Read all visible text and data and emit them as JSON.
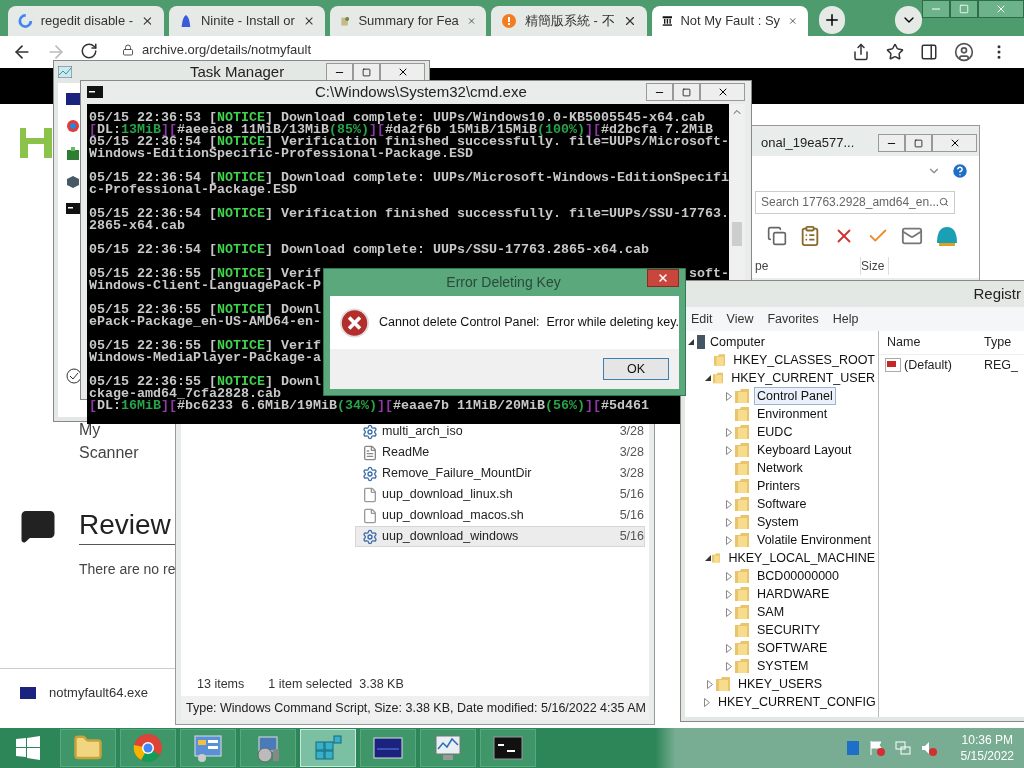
{
  "browser": {
    "tabs": [
      {
        "title": "regedit disable -",
        "kind": "google",
        "selected": false
      },
      {
        "title": "Ninite - Install or",
        "kind": "ninite",
        "selected": false
      },
      {
        "title": "Summary for Fea",
        "kind": "summary",
        "selected": false
      },
      {
        "title": "精簡版系統 - 不",
        "kind": "orange",
        "selected": false
      },
      {
        "title": "Not My Fault : Sy",
        "kind": "archive",
        "selected": true
      }
    ],
    "url": "archive.org/details/notmyfault",
    "page": {
      "side_lines": [
        "My",
        "Scanner"
      ],
      "section_title": "Review",
      "section_text": "There are no re",
      "download": "notmyfault64.exe"
    }
  },
  "explorer_top": {
    "title": "onal_19ea577...",
    "search_placeholder": "Search 17763.2928_amd64_en...",
    "columns": [
      "pe",
      "Size"
    ]
  },
  "explorer_files": {
    "files": [
      {
        "name": "multi_arch_iso",
        "date": "3/28",
        "kind": "script",
        "selected": false
      },
      {
        "name": "ReadMe",
        "date": "3/28",
        "kind": "text",
        "selected": false
      },
      {
        "name": "Remove_Failure_MountDir",
        "date": "3/28",
        "kind": "script",
        "selected": false
      },
      {
        "name": "uup_download_linux.sh",
        "date": "5/16",
        "kind": "blank",
        "selected": false
      },
      {
        "name": "uup_download_macos.sh",
        "date": "5/16",
        "kind": "blank",
        "selected": false
      },
      {
        "name": "uup_download_windows",
        "date": "5/16",
        "kind": "script",
        "selected": true
      }
    ],
    "item_count": "13 items",
    "selection": "1 item selected  3.38 KB",
    "details": "Type: Windows Command Script, Size: 3.38 KB, Date modified: 5/16/2022 4:35 AM"
  },
  "task_manager": {
    "title": "Task Manager"
  },
  "console": {
    "title": "C:\\Windows\\System32\\cmd.exe",
    "entries": [
      {
        "lines": [
          {
            "segments": [
              {
                "text": "05/15 22:36:53 [",
                "kind": "text"
              },
              {
                "text": "NOTICE",
                "kind": "notice"
              },
              {
                "text": "] Download complete: UUPs/Windows10.0-KB5005545-x64.cab",
                "kind": "text"
              }
            ]
          },
          {
            "segments": [
              {
                "text": "[",
                "kind": "bracket"
              },
              {
                "text": "DL:",
                "kind": "text"
              },
              {
                "text": "13MiB",
                "kind": "value"
              },
              {
                "text": "][",
                "kind": "bracket"
              },
              {
                "text": "#aeeac8 11MiB/13MiB",
                "kind": "text"
              },
              {
                "text": "(85%)",
                "kind": "value"
              },
              {
                "text": "][",
                "kind": "bracket"
              },
              {
                "text": "#da2f6b 15MiB/15MiB",
                "kind": "text"
              },
              {
                "text": "(100%)",
                "kind": "value"
              },
              {
                "text": "][",
                "kind": "bracket"
              },
              {
                "text": "#d2bcfa 7.2MiB",
                "kind": "text"
              }
            ]
          },
          {
            "segments": [
              {
                "text": "05/15 22:36:54 [",
                "kind": "text"
              },
              {
                "text": "NOTICE",
                "kind": "notice"
              },
              {
                "text": "] Verification finished successfully. file=UUPs/Microsoft-",
                "kind": "text"
              }
            ]
          },
          {
            "segments": [
              {
                "text": "Windows-EditionSpecific-Professional-Package.ESD",
                "kind": "text"
              }
            ]
          }
        ]
      },
      {
        "lines": [
          {
            "segments": [
              {
                "text": "05/15 22:36:54 [",
                "kind": "text"
              },
              {
                "text": "NOTICE",
                "kind": "notice"
              },
              {
                "text": "] Download complete: UUPs/Microsoft-Windows-EditionSpecifi",
                "kind": "text"
              }
            ]
          },
          {
            "segments": [
              {
                "text": "c-Professional-Package.ESD",
                "kind": "text"
              }
            ]
          }
        ]
      },
      {
        "lines": [
          {
            "segments": [
              {
                "text": "05/15 22:36:54 [",
                "kind": "text"
              },
              {
                "text": "NOTICE",
                "kind": "notice"
              },
              {
                "text": "] Verification finished successfully. file=UUPs/SSU-17763.",
                "kind": "text"
              }
            ]
          },
          {
            "segments": [
              {
                "text": "2865-x64.cab",
                "kind": "text"
              }
            ]
          }
        ]
      },
      {
        "lines": [
          {
            "segments": [
              {
                "text": "05/15 22:36:54 [",
                "kind": "text"
              },
              {
                "text": "NOTICE",
                "kind": "notice"
              },
              {
                "text": "] Download complete: UUPs/SSU-17763.2865-x64.cab",
                "kind": "text"
              }
            ]
          }
        ]
      },
      {
        "lines": [
          {
            "segments": [
              {
                "text": "05/15 22:36:55 [",
                "kind": "text"
              },
              {
                "text": "NOTICE",
                "kind": "notice"
              },
              {
                "text": "] Verif",
                "kind": "text"
              }
            ],
            "tail": "soft-"
          },
          {
            "segments": [
              {
                "text": "Windows-Client-LanguagePack-P",
                "kind": "text"
              }
            ]
          }
        ]
      },
      {
        "lines": [
          {
            "segments": [
              {
                "text": "05/15 22:36:55 [",
                "kind": "text"
              },
              {
                "text": "NOTICE",
                "kind": "notice"
              },
              {
                "text": "] Downl",
                "kind": "text"
              }
            ]
          },
          {
            "segments": [
              {
                "text": "ePack-Package_en-US-AMD64-en-",
                "kind": "text"
              }
            ]
          }
        ]
      },
      {
        "lines": [
          {
            "segments": [
              {
                "text": "05/15 22:36:55 [",
                "kind": "text"
              },
              {
                "text": "NOTICE",
                "kind": "notice"
              },
              {
                "text": "] Verif",
                "kind": "text"
              }
            ]
          },
          {
            "segments": [
              {
                "text": "Windows-MediaPlayer-Package-a",
                "kind": "text"
              }
            ]
          }
        ]
      },
      {
        "lines": [
          {
            "segments": [
              {
                "text": "05/15 22:36:55 [",
                "kind": "text"
              },
              {
                "text": "NOTICE",
                "kind": "notice"
              },
              {
                "text": "] Downl",
                "kind": "text"
              }
            ]
          },
          {
            "segments": [
              {
                "text": "ckage-amd64_7cfa2828.cab",
                "kind": "text"
              }
            ]
          },
          {
            "segments": [
              {
                "text": "[",
                "kind": "bracket"
              },
              {
                "text": "DL:",
                "kind": "text"
              },
              {
                "text": "16MiB",
                "kind": "value"
              },
              {
                "text": "][",
                "kind": "bracket"
              },
              {
                "text": "#bc6233 6.6MiB/19MiB",
                "kind": "text"
              },
              {
                "text": "(34%)",
                "kind": "value"
              },
              {
                "text": "][",
                "kind": "bracket"
              },
              {
                "text": "#eaae7b 11MiB/20MiB",
                "kind": "text"
              },
              {
                "text": "(56%)",
                "kind": "value"
              },
              {
                "text": "][",
                "kind": "bracket"
              },
              {
                "text": "#5d461",
                "kind": "text"
              }
            ]
          }
        ]
      }
    ]
  },
  "registry": {
    "title": "Registr",
    "menu": [
      "Edit",
      "View",
      "Favorites",
      "Help"
    ],
    "tree": {
      "label": "Computer",
      "expanded": true,
      "selected": false,
      "children": [
        {
          "label": "HKEY_CLASSES_ROOT",
          "selected": false
        },
        {
          "label": "HKEY_CURRENT_USER",
          "expanded": true,
          "selected": false,
          "children": [
            {
              "label": "Control Panel",
              "expanded": false,
              "selected": true
            },
            {
              "label": "Environment",
              "selected": false
            },
            {
              "label": "EUDC",
              "expanded": false,
              "selected": false
            },
            {
              "label": "Keyboard Layout",
              "expanded": false,
              "selected": false
            },
            {
              "label": "Network",
              "selected": false
            },
            {
              "label": "Printers",
              "selected": false
            },
            {
              "label": "Software",
              "expanded": false,
              "selected": false
            },
            {
              "label": "System",
              "expanded": false,
              "selected": false
            },
            {
              "label": "Volatile Environment",
              "expanded": false,
              "selected": false
            }
          ]
        },
        {
          "label": "HKEY_LOCAL_MACHINE",
          "expanded": true,
          "selected": false,
          "children": [
            {
              "label": "BCD00000000",
              "expanded": false,
              "selected": false
            },
            {
              "label": "HARDWARE",
              "expanded": false,
              "selected": false
            },
            {
              "label": "SAM",
              "expanded": false,
              "selected": false
            },
            {
              "label": "SECURITY",
              "selected": false
            },
            {
              "label": "SOFTWARE",
              "expanded": false,
              "selected": false
            },
            {
              "label": "SYSTEM",
              "expanded": false,
              "selected": false
            }
          ]
        },
        {
          "label": "HKEY_USERS",
          "expanded": false,
          "selected": false
        },
        {
          "label": "HKEY_CURRENT_CONFIG",
          "expanded": false,
          "selected": false
        }
      ]
    },
    "columns": [
      "Name",
      "Type"
    ],
    "values": [
      {
        "name": "(Default)",
        "type": "REG_"
      }
    ]
  },
  "dialog": {
    "title": "Error Deleting Key",
    "message": "Cannot delete Control Panel:  Error while deleting key.",
    "button": "OK"
  },
  "taskbar": {
    "apps": [
      {
        "kind": "start",
        "active": false
      },
      {
        "kind": "folder",
        "active": false
      },
      {
        "kind": "chrome",
        "active": false
      },
      {
        "kind": "control-panel",
        "active": false
      },
      {
        "kind": "installer",
        "active": false
      },
      {
        "kind": "registry",
        "active": true
      },
      {
        "kind": "blue-window",
        "active": false
      },
      {
        "kind": "monitor",
        "active": false
      },
      {
        "kind": "console",
        "active": false
      }
    ],
    "time": "10:36 PM",
    "date": "5/15/2022"
  }
}
